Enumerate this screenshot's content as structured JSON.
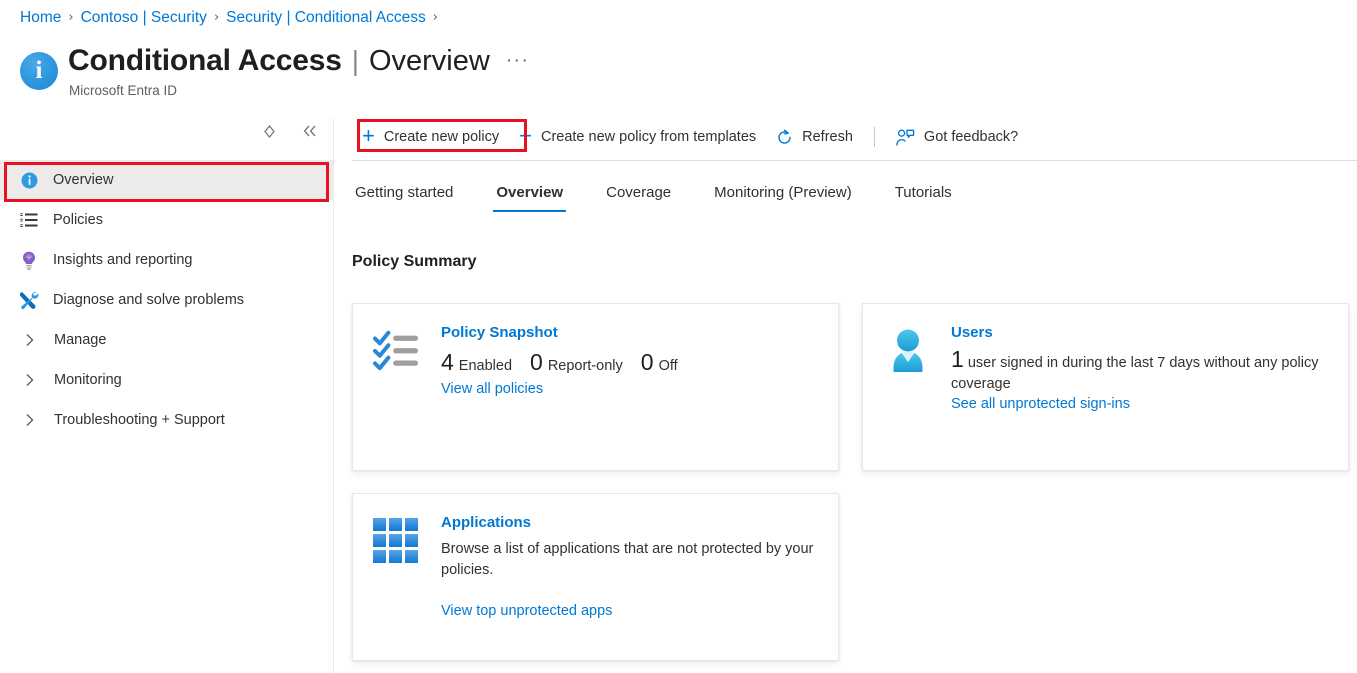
{
  "breadcrumb": {
    "items": [
      "Home",
      "Contoso | Security",
      "Security | Conditional Access"
    ],
    "separator": "›"
  },
  "header": {
    "icon": "info-circle-icon",
    "icon_glyph": "i",
    "title": "Conditional Access",
    "divider": "|",
    "subtitle_page": "Overview",
    "ellipsis": "···",
    "service": "Microsoft Entra ID"
  },
  "sidebar": {
    "tools": [
      {
        "name": "search-toggle",
        "glyph": "◇"
      },
      {
        "name": "collapse-chevron",
        "glyph": "«"
      }
    ],
    "items": [
      {
        "label": "Overview",
        "icon": "info-circle-icon",
        "selected": true,
        "expandable": false
      },
      {
        "label": "Policies",
        "icon": "list-icon",
        "selected": false,
        "expandable": false
      },
      {
        "label": "Insights and reporting",
        "icon": "lightbulb-icon",
        "selected": false,
        "expandable": false
      },
      {
        "label": "Diagnose and solve problems",
        "icon": "wrench-screwdriver-icon",
        "selected": false,
        "expandable": false
      },
      {
        "label": "Manage",
        "icon": "chevron-right-icon",
        "selected": false,
        "expandable": true
      },
      {
        "label": "Monitoring",
        "icon": "chevron-right-icon",
        "selected": false,
        "expandable": true
      },
      {
        "label": "Troubleshooting + Support",
        "icon": "chevron-right-icon",
        "selected": false,
        "expandable": true
      }
    ]
  },
  "toolbar": {
    "create_new_policy": "Create new policy",
    "create_from_templates": "Create new policy from templates",
    "refresh": "Refresh",
    "got_feedback": "Got feedback?",
    "plus_glyph": "+"
  },
  "tabs": [
    {
      "label": "Getting started",
      "active": false
    },
    {
      "label": "Overview",
      "active": true
    },
    {
      "label": "Coverage",
      "active": false
    },
    {
      "label": "Monitoring (Preview)",
      "active": false
    },
    {
      "label": "Tutorials",
      "active": false
    }
  ],
  "main": {
    "section_title": "Policy Summary",
    "cards": {
      "policy_snapshot": {
        "icon": "checklist-icon",
        "title": "Policy Snapshot",
        "stats": [
          {
            "value": "4",
            "label": "Enabled"
          },
          {
            "value": "0",
            "label": "Report-only"
          },
          {
            "value": "0",
            "label": "Off"
          }
        ],
        "link": "View all policies"
      },
      "users": {
        "icon": "user-avatar-icon",
        "title": "Users",
        "value": "1",
        "description": "user signed in during the last 7 days without any policy coverage",
        "link": "See all unprotected sign-ins"
      },
      "applications": {
        "icon": "app-grid-icon",
        "title": "Applications",
        "description": "Browse a list of applications that are not protected by your policies.",
        "link": "View top unprotected apps"
      }
    }
  },
  "annotations": [
    {
      "name": "overview-nav-highlight",
      "color": "#e81123"
    },
    {
      "name": "create-new-policy-highlight",
      "color": "#e81123"
    }
  ]
}
